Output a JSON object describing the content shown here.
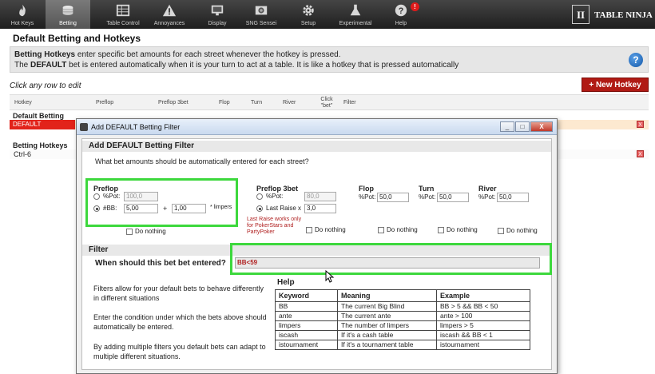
{
  "toolbar": {
    "items": [
      {
        "label": "Hot Keys",
        "icon": "flame-icon"
      },
      {
        "label": "Betting",
        "icon": "chips-icon"
      },
      {
        "label": "Table Control",
        "icon": "table-icon"
      },
      {
        "label": "Annoyances",
        "icon": "warning-icon"
      },
      {
        "label": "Display",
        "icon": "monitor-icon"
      },
      {
        "label": "SNG Sensei",
        "icon": "camera-icon"
      },
      {
        "label": "Setup",
        "icon": "gear-icon"
      },
      {
        "label": "Experimental",
        "icon": "flask-icon"
      },
      {
        "label": "Help",
        "icon": "question-icon"
      }
    ],
    "active": "Betting",
    "alert_badge": "!",
    "logo_text": "TABLE NINJA",
    "logo_mark": "II"
  },
  "page": {
    "title": "Default Betting and Hotkeys",
    "info_line1_bold": "Betting Hotkeys",
    "info_line1_rest": " enter specific bet amounts for each street whenever the hotkey is pressed.",
    "info_line2_pre": "The ",
    "info_line2_bold": "DEFAULT",
    "info_line2_rest": " bet is entered automatically when it is your turn to act at a table. It is like a hotkey that is pressed automatically",
    "help_btn": "?",
    "click_hint": "Click any row to edit",
    "new_hotkey": "+ New Hotkey"
  },
  "table": {
    "headers": [
      "Hotkey",
      "Preflop",
      "Preflop 3bet",
      "Flop",
      "Turn",
      "River",
      "Click \"bet\"",
      "Filter"
    ],
    "group_default": "Default Betting",
    "row_default": "DEFAULT",
    "group_hotkeys": "Betting Hotkeys",
    "row_ctrl": "Ctrl-6",
    "delete_glyph": "X"
  },
  "dialog": {
    "title": "Add DEFAULT Betting Filter",
    "win_min": "_",
    "win_max": "□",
    "win_close": "X",
    "section1": "Add DEFAULT Betting Filter",
    "question": "What bet amounts should be automatically entered for each street?",
    "preflop": {
      "title": "Preflop",
      "pot_label": "%Pot:",
      "pot_value": "100,0",
      "bb_label": "#BB:",
      "bb_value": "5,00",
      "dash": "+",
      "limp_value": "1,00",
      "limpers": "* limpers",
      "do_nothing": "Do nothing"
    },
    "preflop3bet": {
      "title": "Preflop 3bet",
      "pot_label": "%Pot:",
      "pot_value": "80,0",
      "raise_label": "Last Raise x",
      "raise_value": "3,0",
      "note": "Last Raise works only for PokerStars and PartyPoker",
      "do_nothing": "Do nothing"
    },
    "flop": {
      "title": "Flop",
      "pot_label": "%Pot:",
      "pot_value": "50,0",
      "do_nothing": "Do nothing"
    },
    "turn": {
      "title": "Turn",
      "pot_label": "%Pot:",
      "pot_value": "50,0",
      "do_nothing": "Do nothing"
    },
    "river": {
      "title": "River",
      "pot_label": "%Pot:",
      "pot_value": "50,0",
      "do_nothing": "Do nothing"
    },
    "section2": "Filter",
    "filter_question": "When should this bet bet entered?",
    "filter_value": "BB<59",
    "desc1": "Filters allow for your default bets to behave differently in different situations",
    "desc2": "Enter the condition under which the bets above should automatically be entered.",
    "desc3": "By adding multiple filters you default bets can adapt to multiple different situations.",
    "help_title": "Help",
    "help_headers": [
      "Keyword",
      "Meaning",
      "Example"
    ],
    "help_rows": [
      [
        "BB",
        "The current Big Blind",
        "BB > 5 && BB < 50"
      ],
      [
        "ante",
        "The current ante",
        "ante > 100"
      ],
      [
        "limpers",
        "The number of limpers",
        "limpers > 5"
      ],
      [
        "iscash",
        "If it's a cash table",
        "iscash && BB < 1"
      ],
      [
        "istournament",
        "If it's a tournament table",
        "istournament"
      ]
    ]
  }
}
